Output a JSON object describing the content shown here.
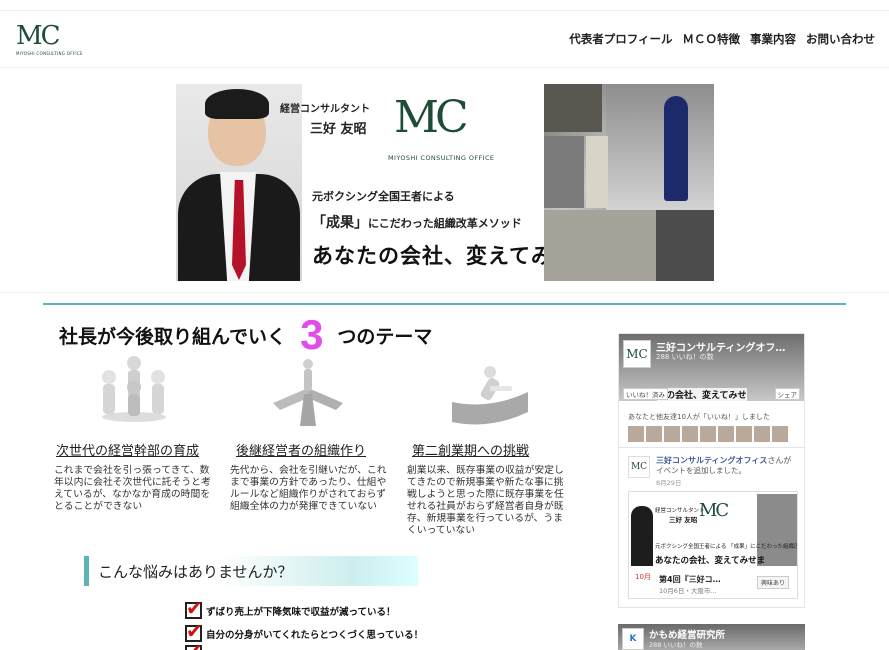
{
  "header": {
    "logo_mark": "MC",
    "logo_sub": "MIYOSHI CONSULTING OFFICE",
    "nav": [
      "代表者プロフィール",
      "ＭＣＯ特徴",
      "事業内容",
      "お問い合わせ"
    ]
  },
  "hero": {
    "title_small": "経営コンサルタント",
    "name": "三好 友昭",
    "logo_mark": "MC",
    "logo_sub": "MIYOSHI CONSULTING OFFICE",
    "line1": "元ボクシング全国王者による",
    "line2_em": "「成果」",
    "line2_rest": "にこだわった組織改革メソッド",
    "catch": "あなたの会社、変えてみせます。"
  },
  "themes": {
    "heading_pre": "社長が今後取り組んでいく",
    "heading_num": "3",
    "heading_post": "つのテーマ",
    "items": [
      {
        "icon": "people-circle-icon",
        "title": "次世代の経営幹部の育成",
        "body": "これまで会社を引っ張ってきて、数年以内に会社そ次世代に託そうと考えているが、なかなか育成の時間をとることができない"
      },
      {
        "icon": "crossroads-arrows-icon",
        "title": "後継経営者の組織作り",
        "body": "先代から、会社を引継いだが、これまで事業の方針であったり、仕組やルールなど組織作りがされておらず組織全体の力が発揮できていない"
      },
      {
        "icon": "ramp-push-icon",
        "title": "第二創業期への挑戦",
        "body": "創業以来、既存事業の収益が安定してきたので新規事業や新たな事に挑戦しようと思った際に既存事業を任せれる社員がおらず経営者自身が既存、新規事業を行っているが、うまくいっていない"
      }
    ]
  },
  "worries": {
    "heading": "こんな悩みはありませんか？",
    "items": [
      "ずばり売上が下降気味で収益が減っている！",
      "自分の分身がいてくれたらとつくづく思っている！"
    ]
  },
  "facebook": {
    "page_name": "三好コンサルティングオフ…",
    "likes": "288 いいね！の数",
    "like_btn": "いいね！済み",
    "share_btn": "シェア",
    "cover_catch": "たの会社、変えてみせ",
    "friends": "あなたと他友達10人が「いいね！」しました",
    "post_name": "三好コンサルティングオフィス",
    "post_suffix": "さんが",
    "post_text": "イベントを追加しました。",
    "post_date": "8月29日",
    "img_label": "経営コンサルタント",
    "img_name": "三好 友昭",
    "img_mark": "MC",
    "img_line": "元ボクシング全国王者による 「成果」にこだわった組織改革メソッド",
    "img_catch": "あなたの会社、変えてみせま",
    "event_month": "10月",
    "event_title": "第4回『三好コ…",
    "event_date": "10月6日・大阪市…",
    "event_btn": "興味あり",
    "page2_name": "かもめ経営研究所",
    "page2_likes": "288 いいね！の数",
    "page2_thumb": "K"
  }
}
